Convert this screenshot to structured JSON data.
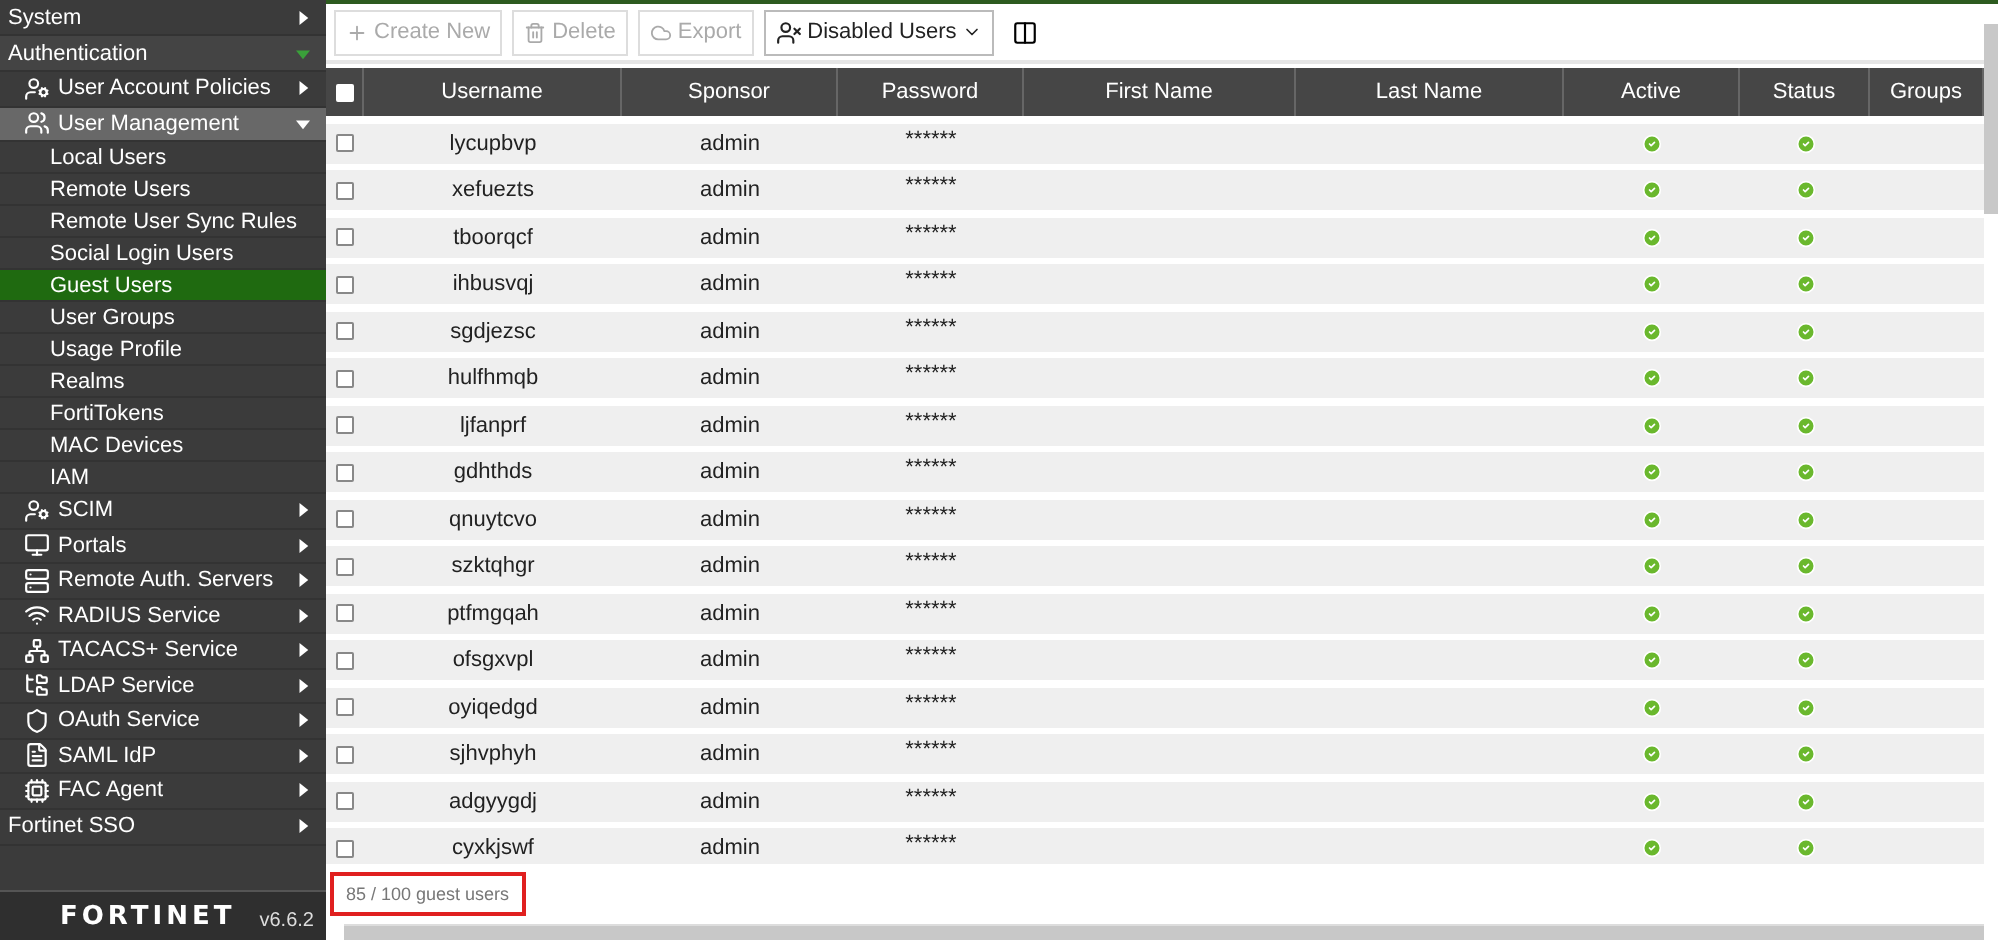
{
  "sidebar": {
    "items": [
      {
        "label": "System",
        "expanded": false
      },
      {
        "label": "Authentication",
        "expanded": true,
        "children": [
          {
            "label": "User Account Policies",
            "expanded": false
          },
          {
            "label": "User Management",
            "expanded": true,
            "children": [
              {
                "label": "Local Users",
                "selected": false
              },
              {
                "label": "Remote Users",
                "selected": false
              },
              {
                "label": "Remote User Sync Rules",
                "selected": false
              },
              {
                "label": "Social Login Users",
                "selected": false
              },
              {
                "label": "Guest Users",
                "selected": true
              },
              {
                "label": "User Groups",
                "selected": false
              },
              {
                "label": "Usage Profile",
                "selected": false
              },
              {
                "label": "Realms",
                "selected": false
              },
              {
                "label": "FortiTokens",
                "selected": false
              },
              {
                "label": "MAC Devices",
                "selected": false
              },
              {
                "label": "IAM",
                "selected": false
              }
            ]
          },
          {
            "label": "SCIM",
            "expanded": false
          },
          {
            "label": "Portals",
            "expanded": false
          },
          {
            "label": "Remote Auth. Servers",
            "expanded": false
          },
          {
            "label": "RADIUS Service",
            "expanded": false
          },
          {
            "label": "TACACS+ Service",
            "expanded": false
          },
          {
            "label": "LDAP Service",
            "expanded": false
          },
          {
            "label": "OAuth Service",
            "expanded": false
          },
          {
            "label": "SAML IdP",
            "expanded": false
          },
          {
            "label": "FAC Agent",
            "expanded": false
          }
        ]
      },
      {
        "label": "Fortinet SSO",
        "expanded": false
      }
    ],
    "logo": "FORTINET",
    "version": "v6.6.2"
  },
  "toolbar": {
    "buttons": [
      {
        "label": "Create New",
        "disabled": true
      },
      {
        "label": "Delete",
        "disabled": true
      },
      {
        "label": "Export",
        "disabled": true
      }
    ],
    "filter": {
      "label": "Disabled Users"
    }
  },
  "table": {
    "columns": [
      "Username",
      "Sponsor",
      "Password",
      "First Name",
      "Last Name",
      "Active",
      "Status",
      "Groups"
    ],
    "all_checked": false,
    "rows": [
      {
        "username": "lycupbvp",
        "sponsor": "admin",
        "password": "******",
        "active": true,
        "status": true,
        "checked": false
      },
      {
        "username": "xefuezts",
        "sponsor": "admin",
        "password": "******",
        "active": true,
        "status": true,
        "checked": false
      },
      {
        "username": "tboorqcf",
        "sponsor": "admin",
        "password": "******",
        "active": true,
        "status": true,
        "checked": false
      },
      {
        "username": "ihbusvqj",
        "sponsor": "admin",
        "password": "******",
        "active": true,
        "status": true,
        "checked": false
      },
      {
        "username": "sgdjezsc",
        "sponsor": "admin",
        "password": "******",
        "active": true,
        "status": true,
        "checked": false
      },
      {
        "username": "hulfhmqb",
        "sponsor": "admin",
        "password": "******",
        "active": true,
        "status": true,
        "checked": false
      },
      {
        "username": "ljfanprf",
        "sponsor": "admin",
        "password": "******",
        "active": true,
        "status": true,
        "checked": false
      },
      {
        "username": "gdhthds",
        "sponsor": "admin",
        "password": "******",
        "active": true,
        "status": true,
        "checked": false
      },
      {
        "username": "qnuytcvo",
        "sponsor": "admin",
        "password": "******",
        "active": true,
        "status": true,
        "checked": false
      },
      {
        "username": "szktqhgr",
        "sponsor": "admin",
        "password": "******",
        "active": true,
        "status": true,
        "checked": false
      },
      {
        "username": "ptfmgqah",
        "sponsor": "admin",
        "password": "******",
        "active": true,
        "status": true,
        "checked": false
      },
      {
        "username": "ofsgxvpl",
        "sponsor": "admin",
        "password": "******",
        "active": true,
        "status": true,
        "checked": false
      },
      {
        "username": "oyiqedgd",
        "sponsor": "admin",
        "password": "******",
        "active": true,
        "status": true,
        "checked": false
      },
      {
        "username": "sjhvphyh",
        "sponsor": "admin",
        "password": "******",
        "active": true,
        "status": true,
        "checked": false
      },
      {
        "username": "adgyygdj",
        "sponsor": "admin",
        "password": "******",
        "active": true,
        "status": true,
        "checked": false
      },
      {
        "username": "cyxkjswf",
        "sponsor": "admin",
        "password": "******",
        "active": true,
        "status": true,
        "checked": false
      }
    ]
  },
  "footer": {
    "count": "85 / 100 guest users"
  }
}
